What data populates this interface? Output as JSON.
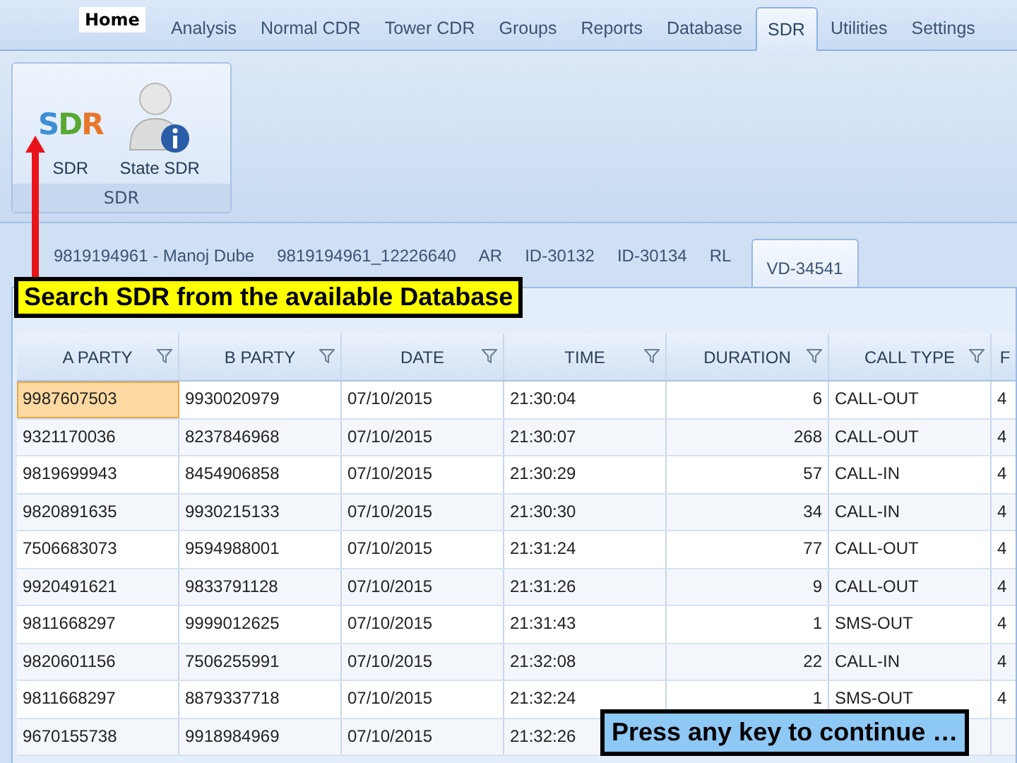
{
  "ribbon_tabs": [
    {
      "label": "Home",
      "kind": "home",
      "selected": false
    },
    {
      "label": "Analysis",
      "kind": "tab",
      "selected": false
    },
    {
      "label": "Normal CDR",
      "kind": "tab",
      "selected": false
    },
    {
      "label": "Tower CDR",
      "kind": "tab",
      "selected": false
    },
    {
      "label": "Groups",
      "kind": "tab",
      "selected": false
    },
    {
      "label": "Reports",
      "kind": "tab",
      "selected": false
    },
    {
      "label": "Database",
      "kind": "tab",
      "selected": false
    },
    {
      "label": "SDR",
      "kind": "tab",
      "selected": true
    },
    {
      "label": "Utilities",
      "kind": "tab",
      "selected": false
    },
    {
      "label": "Settings",
      "kind": "tab",
      "selected": false
    }
  ],
  "ribbon_group": {
    "title": "SDR",
    "buttons": [
      {
        "label": "SDR",
        "kind": "logo",
        "logo": [
          "S",
          "D",
          "R"
        ]
      },
      {
        "label": "State SDR",
        "kind": "user"
      }
    ]
  },
  "document_tabs": [
    {
      "label": "9819194961 - Manoj Dube",
      "selected": false
    },
    {
      "label": "9819194961_12226640",
      "selected": false
    },
    {
      "label": "AR",
      "selected": false
    },
    {
      "label": "ID-30132",
      "selected": false
    },
    {
      "label": "ID-30134",
      "selected": false
    },
    {
      "label": "RL",
      "selected": false
    },
    {
      "label": "VD-34541",
      "selected": true
    }
  ],
  "callout": "Search SDR from the available Database",
  "table": {
    "columns": [
      "A PARTY",
      "B PARTY",
      "DATE",
      "TIME",
      "DURATION",
      "CALL TYPE",
      "F"
    ],
    "rows": [
      {
        "cells": [
          "9987607503",
          "9930020979",
          "07/10/2015",
          "21:30:04",
          "6",
          "CALL-OUT",
          "4"
        ],
        "selected": true
      },
      {
        "cells": [
          "9321170036",
          "8237846968",
          "07/10/2015",
          "21:30:07",
          "268",
          "CALL-OUT",
          "4"
        ],
        "selected": false
      },
      {
        "cells": [
          "9819699943",
          "8454906858",
          "07/10/2015",
          "21:30:29",
          "57",
          "CALL-IN",
          "4"
        ],
        "selected": false
      },
      {
        "cells": [
          "9820891635",
          "9930215133",
          "07/10/2015",
          "21:30:30",
          "34",
          "CALL-IN",
          "4"
        ],
        "selected": false
      },
      {
        "cells": [
          "7506683073",
          "9594988001",
          "07/10/2015",
          "21:31:24",
          "77",
          "CALL-OUT",
          "4"
        ],
        "selected": false
      },
      {
        "cells": [
          "9920491621",
          "9833791128",
          "07/10/2015",
          "21:31:26",
          "9",
          "CALL-OUT",
          "4"
        ],
        "selected": false
      },
      {
        "cells": [
          "9811668297",
          "9999012625",
          "07/10/2015",
          "21:31:43",
          "1",
          "SMS-OUT",
          "4"
        ],
        "selected": false
      },
      {
        "cells": [
          "9820601156",
          "7506255991",
          "07/10/2015",
          "21:32:08",
          "22",
          "CALL-IN",
          "4"
        ],
        "selected": false
      },
      {
        "cells": [
          "9811668297",
          "8879337718",
          "07/10/2015",
          "21:32:24",
          "1",
          "SMS-OUT",
          "4"
        ],
        "selected": false
      },
      {
        "cells": [
          "9670155738",
          "9918984969",
          "07/10/2015",
          "21:32:26"
        ],
        "selected": false
      }
    ]
  },
  "prompt": "Press any key to continue …"
}
